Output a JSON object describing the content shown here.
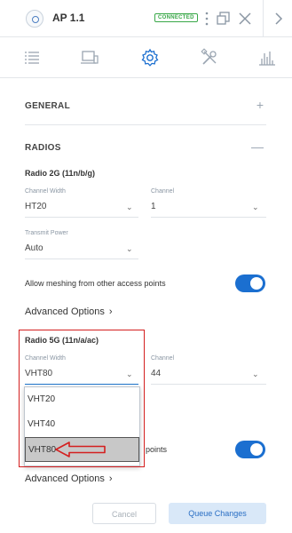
{
  "header": {
    "device_title": "AP 1.1",
    "status_badge": "CONNECTED",
    "icons": [
      "access-point-icon",
      "more-vertical-icon",
      "restore-window-icon",
      "close-icon",
      "chevron-right-icon"
    ]
  },
  "tabs": [
    {
      "name": "details",
      "icon": "list-icon",
      "active": false
    },
    {
      "name": "devices",
      "icon": "device-monitor-icon",
      "active": false
    },
    {
      "name": "configuration",
      "icon": "gear-icon",
      "active": true
    },
    {
      "name": "tools",
      "icon": "tools-icon",
      "active": false
    },
    {
      "name": "statistics",
      "icon": "bar-chart-icon",
      "active": false
    }
  ],
  "sections": {
    "general": {
      "title": "GENERAL",
      "toggle": "+"
    },
    "radios": {
      "title": "RADIOS",
      "toggle": "—"
    }
  },
  "radio_2g": {
    "title": "Radio 2G (11n/b/g)",
    "channel_width_label": "Channel Width",
    "channel_width_value": "HT20",
    "channel_label": "Channel",
    "channel_value": "1",
    "transmit_power_label": "Transmit Power",
    "transmit_power_value": "Auto"
  },
  "meshing": {
    "label": "Allow meshing from other access points",
    "enabled": true
  },
  "advanced_options_1": "Advanced Options",
  "radio_5g": {
    "title": "Radio 5G (11n/a/ac)",
    "channel_width_label": "Channel Width",
    "channel_width_value": "VHT80",
    "channel_label": "Channel",
    "channel_value": "44"
  },
  "dropdown": {
    "options": [
      "VHT20",
      "VHT40",
      "VHT80"
    ],
    "selected": "VHT80"
  },
  "meshing_5g": {
    "label_visible": "points",
    "enabled": true
  },
  "advanced_options_2": "Advanced Options",
  "footer": {
    "cancel_label": "Cancel",
    "queue_label": "Queue Changes"
  },
  "colors": {
    "accent": "#1b6fd0",
    "annotation": "#d41f1f",
    "connected": "#39a848"
  }
}
